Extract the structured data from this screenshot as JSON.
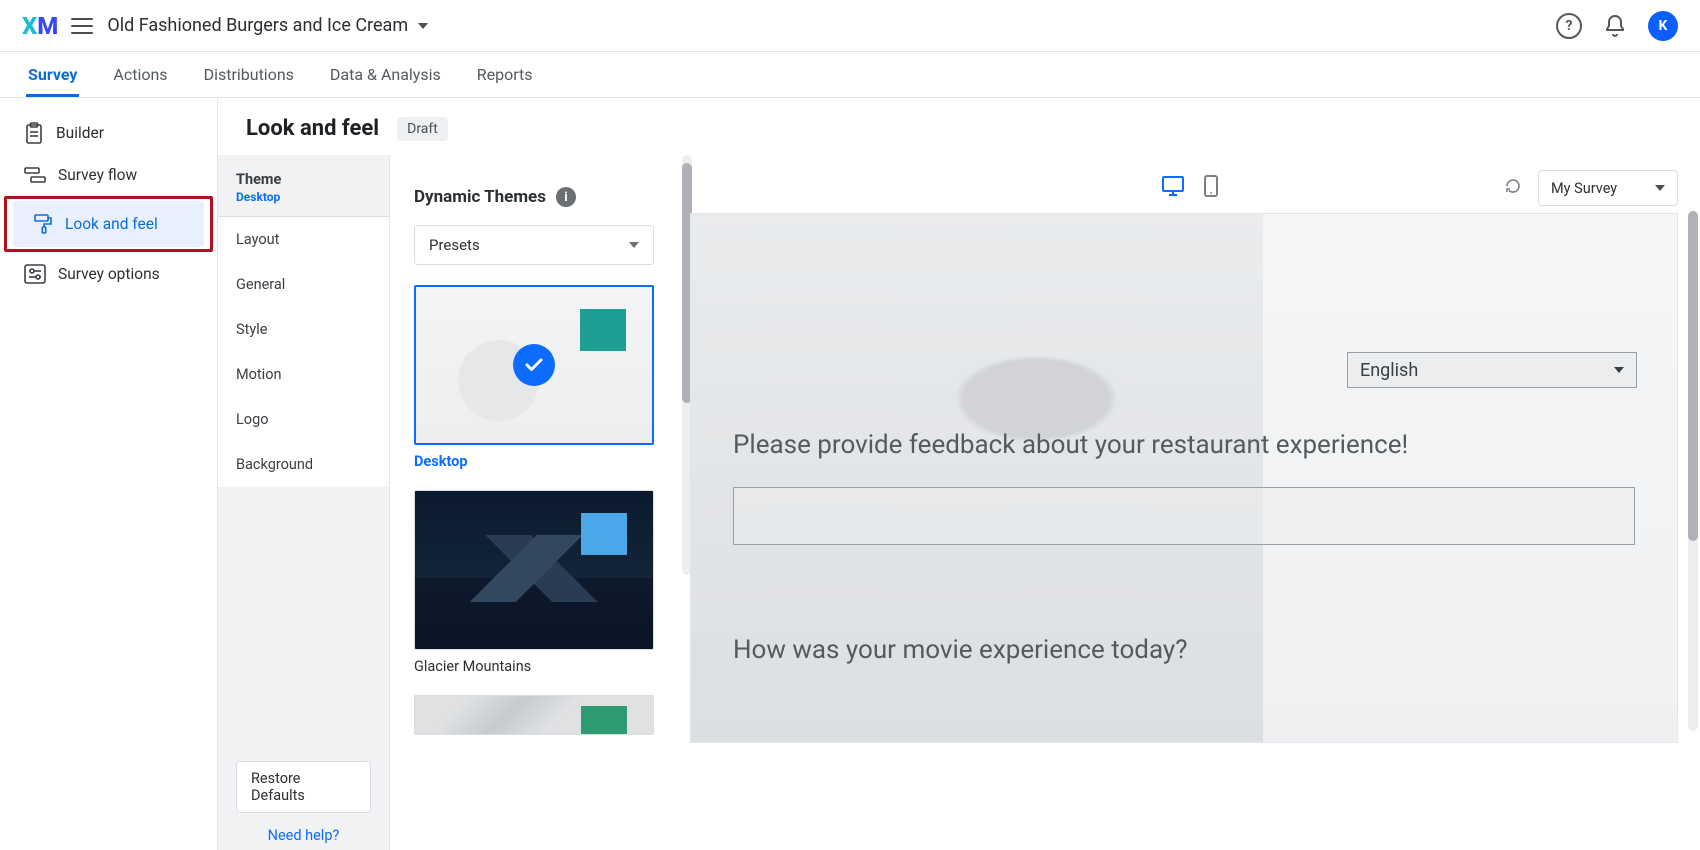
{
  "header": {
    "logo_text_x": "X",
    "logo_text_m": "M",
    "project_name": "Old Fashioned Burgers and Ice Cream",
    "avatar_initial": "K"
  },
  "top_tabs": {
    "survey": "Survey",
    "actions": "Actions",
    "distributions": "Distributions",
    "data": "Data & Analysis",
    "reports": "Reports"
  },
  "left_nav": {
    "builder": "Builder",
    "flow": "Survey flow",
    "look": "Look and feel",
    "options": "Survey options"
  },
  "page": {
    "title": "Look and feel",
    "status_badge": "Draft"
  },
  "settings": {
    "theme_title": "Theme",
    "theme_mode": "Desktop",
    "items": {
      "layout": "Layout",
      "general": "General",
      "style": "Style",
      "motion": "Motion",
      "logo": "Logo",
      "background": "Background"
    },
    "restore": "Restore Defaults",
    "need_help": "Need help?"
  },
  "themes": {
    "section_title": "Dynamic Themes",
    "presets_label": "Presets",
    "cards": {
      "desktop": "Desktop",
      "glacier": "Glacier Mountains"
    }
  },
  "preview": {
    "survey_dropdown": "My Survey",
    "language": "English",
    "q1": "Please provide feedback about your restaurant experience!",
    "q2": "How was your movie experience today?"
  }
}
